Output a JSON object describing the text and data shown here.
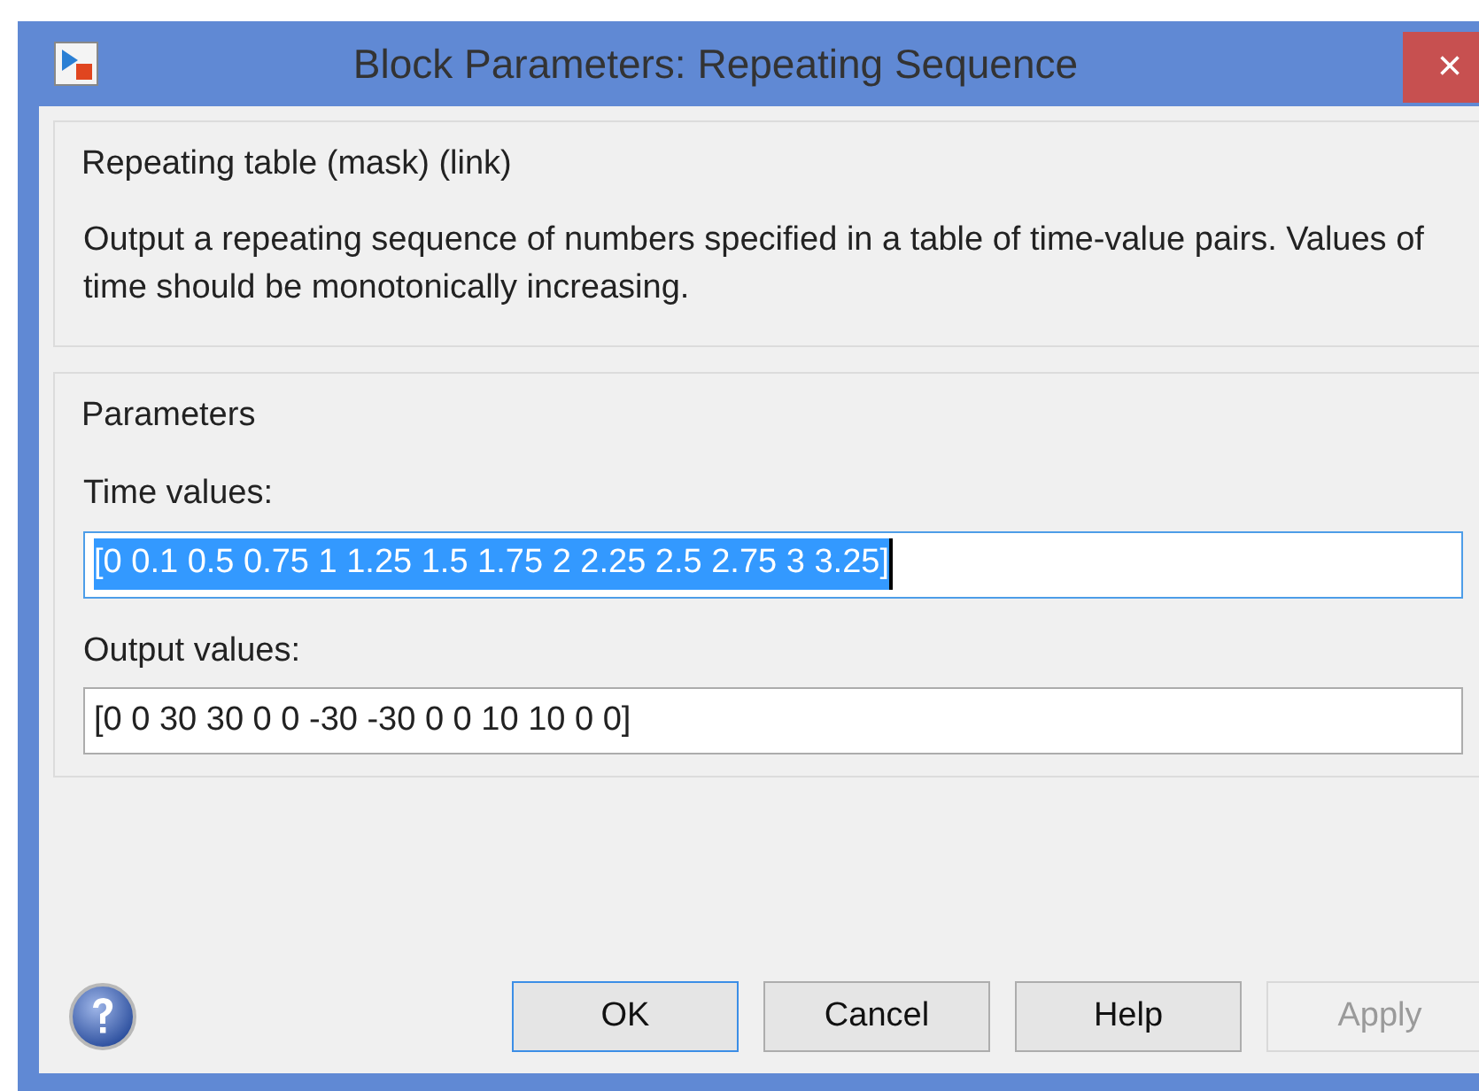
{
  "window": {
    "title": "Block Parameters: Repeating Sequence",
    "close": "×"
  },
  "mask": {
    "title": "Repeating table (mask) (link)",
    "description": "Output a repeating sequence of numbers specified in a table of time-value pairs. Values of time should be monotonically increasing."
  },
  "parameters": {
    "title": "Parameters",
    "fields": [
      {
        "label": "Time values:",
        "value": "[0 0.1 0.5 0.75 1 1.25 1.5 1.75 2 2.25 2.5 2.75 3 3.25]",
        "focused": true
      },
      {
        "label": "Output values:",
        "value": "[0 0 30 30 0 0 -30 -30 0 0 10 10 0 0]",
        "focused": false
      }
    ]
  },
  "buttons": [
    {
      "label": "OK",
      "default": true,
      "disabled": false
    },
    {
      "label": "Cancel",
      "default": false,
      "disabled": false
    },
    {
      "label": "Help",
      "default": false,
      "disabled": false
    },
    {
      "label": "Apply",
      "default": false,
      "disabled": true
    }
  ]
}
